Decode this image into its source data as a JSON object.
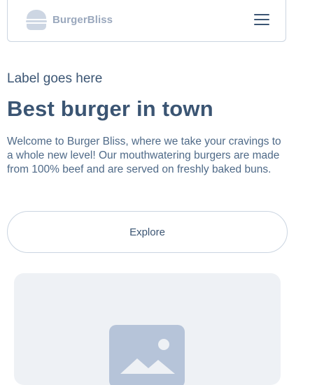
{
  "navbar": {
    "brand_name": "BurgerBliss",
    "logo_icon": "burger-icon",
    "menu_icon": "hamburger-menu-icon"
  },
  "hero": {
    "label": "Label goes here",
    "title": "Best burger in town",
    "description": "Welcome to Burger Bliss, where we take your cravings to a whole new level! Our mouthwatering burgers are made from 100% beef and are served on freshly baked buns.",
    "button_label": "Explore"
  },
  "image_placeholder": {
    "icon": "image-placeholder-icon"
  },
  "colors": {
    "text": "#3b5573",
    "border": "#cbd5e1",
    "logo": "#cdd6e3",
    "placeholder_bg": "#eef1f5",
    "placeholder_icon": "#b6c4d9"
  }
}
